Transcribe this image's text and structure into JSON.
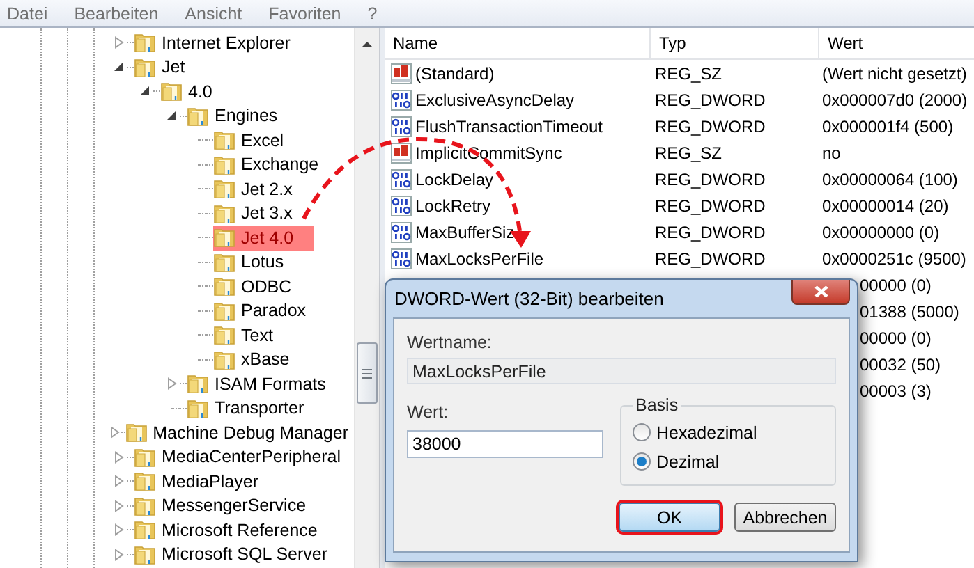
{
  "menu": [
    "Datei",
    "Bearbeiten",
    "Ansicht",
    "Favoriten",
    "?"
  ],
  "tree": {
    "items": [
      {
        "label": "Internet Explorer",
        "kind": "collapsed",
        "highlighted": false
      },
      {
        "label": "Jet",
        "kind": "expanded",
        "highlighted": false,
        "children": [
          {
            "label": "4.0",
            "kind": "expanded",
            "highlighted": false,
            "children": [
              {
                "label": "Engines",
                "kind": "expanded",
                "highlighted": false,
                "children": [
                  {
                    "label": "Excel",
                    "kind": "leaf",
                    "highlighted": false
                  },
                  {
                    "label": "Exchange",
                    "kind": "leaf",
                    "highlighted": false
                  },
                  {
                    "label": "Jet 2.x",
                    "kind": "leaf",
                    "highlighted": false
                  },
                  {
                    "label": "Jet 3.x",
                    "kind": "leaf",
                    "highlighted": false
                  },
                  {
                    "label": "Jet 4.0",
                    "kind": "leaf",
                    "highlighted": true
                  },
                  {
                    "label": "Lotus",
                    "kind": "leaf",
                    "highlighted": false
                  },
                  {
                    "label": "ODBC",
                    "kind": "leaf",
                    "highlighted": false
                  },
                  {
                    "label": "Paradox",
                    "kind": "leaf",
                    "highlighted": false
                  },
                  {
                    "label": "Text",
                    "kind": "leaf",
                    "highlighted": false
                  },
                  {
                    "label": "xBase",
                    "kind": "leaf",
                    "highlighted": false
                  }
                ]
              },
              {
                "label": "ISAM Formats",
                "kind": "collapsed",
                "highlighted": false
              },
              {
                "label": "Transporter",
                "kind": "leaf",
                "highlighted": false
              }
            ]
          }
        ]
      },
      {
        "label": "Machine Debug Manager",
        "kind": "collapsed",
        "highlighted": false
      },
      {
        "label": "MediaCenterPeripheral",
        "kind": "collapsed",
        "highlighted": false
      },
      {
        "label": "MediaPlayer",
        "kind": "collapsed",
        "highlighted": false
      },
      {
        "label": "MessengerService",
        "kind": "collapsed",
        "highlighted": false
      },
      {
        "label": "Microsoft Reference",
        "kind": "collapsed",
        "highlighted": false
      },
      {
        "label": "Microsoft SQL Server",
        "kind": "collapsed",
        "highlighted": false
      }
    ]
  },
  "table": {
    "columns": [
      "Name",
      "Typ",
      "Wert"
    ],
    "rows": [
      {
        "kind": "string",
        "name": "(Standard)",
        "type": "REG_SZ",
        "value": "(Wert nicht gesetzt)"
      },
      {
        "kind": "dword",
        "name": "ExclusiveAsyncDelay",
        "type": "REG_DWORD",
        "value": "0x000007d0 (2000)"
      },
      {
        "kind": "dword",
        "name": "FlushTransactionTimeout",
        "type": "REG_DWORD",
        "value": "0x000001f4 (500)"
      },
      {
        "kind": "string",
        "name": "ImplicitCommitSync",
        "type": "REG_SZ",
        "value": "no"
      },
      {
        "kind": "dword",
        "name": "LockDelay",
        "type": "REG_DWORD",
        "value": "0x00000064 (100)"
      },
      {
        "kind": "dword",
        "name": "LockRetry",
        "type": "REG_DWORD",
        "value": "0x00000014 (20)"
      },
      {
        "kind": "dword",
        "name": "MaxBufferSiz",
        "type": "REG_DWORD",
        "value": "0x00000000 (0)"
      },
      {
        "kind": "dword",
        "name": "MaxLocksPerFile",
        "type": "REG_DWORD",
        "value": "0x0000251c (9500)"
      },
      {
        "kind": "partial",
        "value": "00000 (0)"
      },
      {
        "kind": "partial",
        "value": "01388 (5000)"
      },
      {
        "kind": "partial",
        "value": "00000 (0)"
      },
      {
        "kind": "partial",
        "value": "00032 (50)"
      },
      {
        "kind": "partial",
        "value": "00003 (3)"
      }
    ]
  },
  "dialog": {
    "title": "DWORD-Wert (32-Bit) bearbeiten",
    "name_label": "Wertname:",
    "name_value": "MaxLocksPerFile",
    "value_label": "Wert:",
    "value": "38000",
    "base_label": "Basis",
    "bases": [
      {
        "label": "Hexadezimal",
        "selected": false
      },
      {
        "label": "Dezimal",
        "selected": true
      }
    ],
    "buttons": [
      {
        "label": "OK",
        "highlighted": true
      },
      {
        "label": "Abbrechen",
        "highlighted": false
      }
    ]
  }
}
